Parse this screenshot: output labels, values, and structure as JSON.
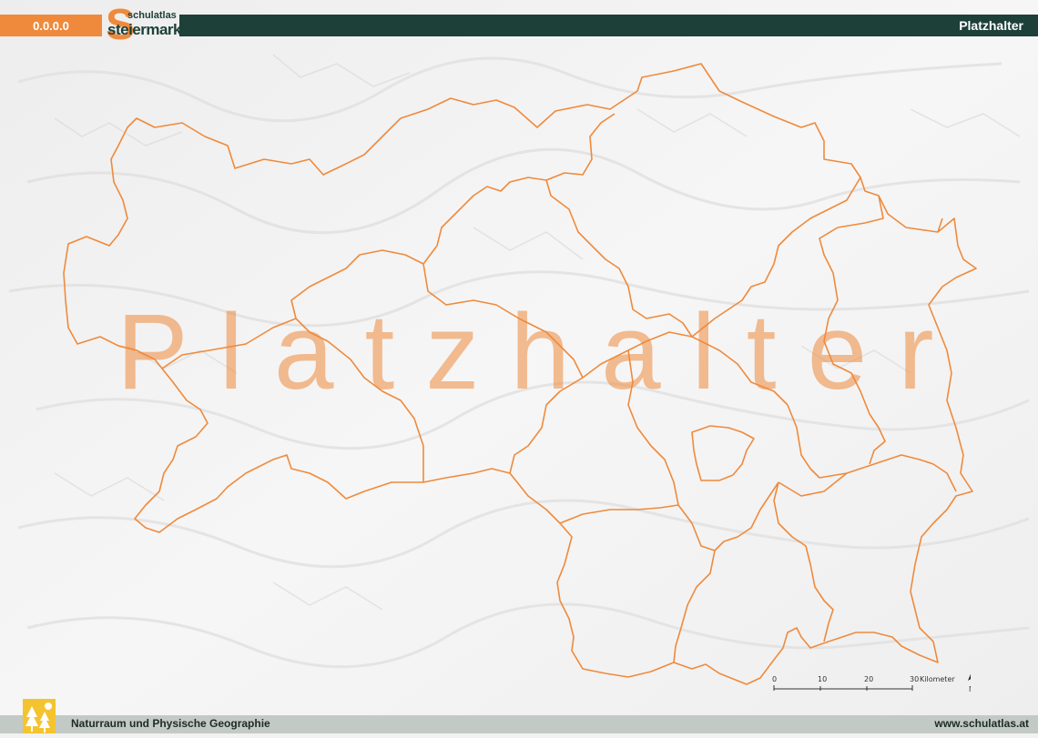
{
  "header": {
    "code": "0.0.0.0",
    "logo_letter": "S",
    "logo_top": "schulatlas",
    "logo_main": "steiermark",
    "title": "Platzhalter"
  },
  "map": {
    "watermark": "Platzhalter",
    "boundary_color": "#ef8a3c",
    "relief_color": "#f2f2f2",
    "scale": {
      "ticks": [
        "0",
        "10",
        "20",
        "30"
      ],
      "unit": "Kilometer"
    },
    "north_label": "N",
    "north_icon": "north-arrow-icon"
  },
  "footer": {
    "subject": "Naturraum und Physische Geographie",
    "url": "www.schulatlas.at",
    "icon": "tree-sun-icon"
  },
  "colors": {
    "accent": "#ef8a3c",
    "dark": "#1d4038",
    "footer_bg": "#c3c9c4",
    "icon_bg": "#f4c430"
  }
}
